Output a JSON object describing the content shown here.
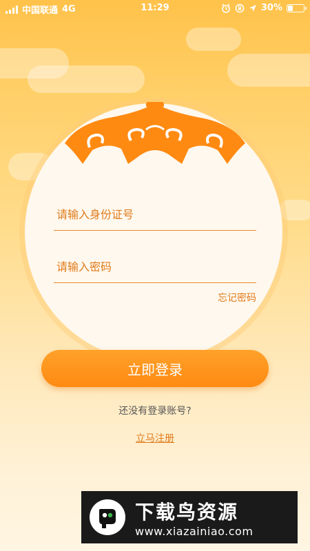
{
  "status_bar": {
    "carrier": "中国联通",
    "network": "4G",
    "time": "11:29",
    "battery": "30%",
    "battery_level": 0.3,
    "icons": [
      "signal-icon",
      "alarm-icon",
      "rotation-lock-icon",
      "location-icon",
      "battery-icon"
    ]
  },
  "form": {
    "id_placeholder": "请输入身份证号",
    "password_placeholder": "请输入密码",
    "forgot_password": "忘记密码",
    "login_button": "立即登录",
    "no_account": "还没有登录账号?",
    "register_link": "立马注册"
  },
  "watermark": {
    "title": "下载鸟资源",
    "url": "www.xiazainiao.com"
  },
  "colors": {
    "accent": "#FF8A12",
    "text_accent": "#E07A1A",
    "background_top": "#FFC24A",
    "background_bottom": "#FFF5E2"
  }
}
